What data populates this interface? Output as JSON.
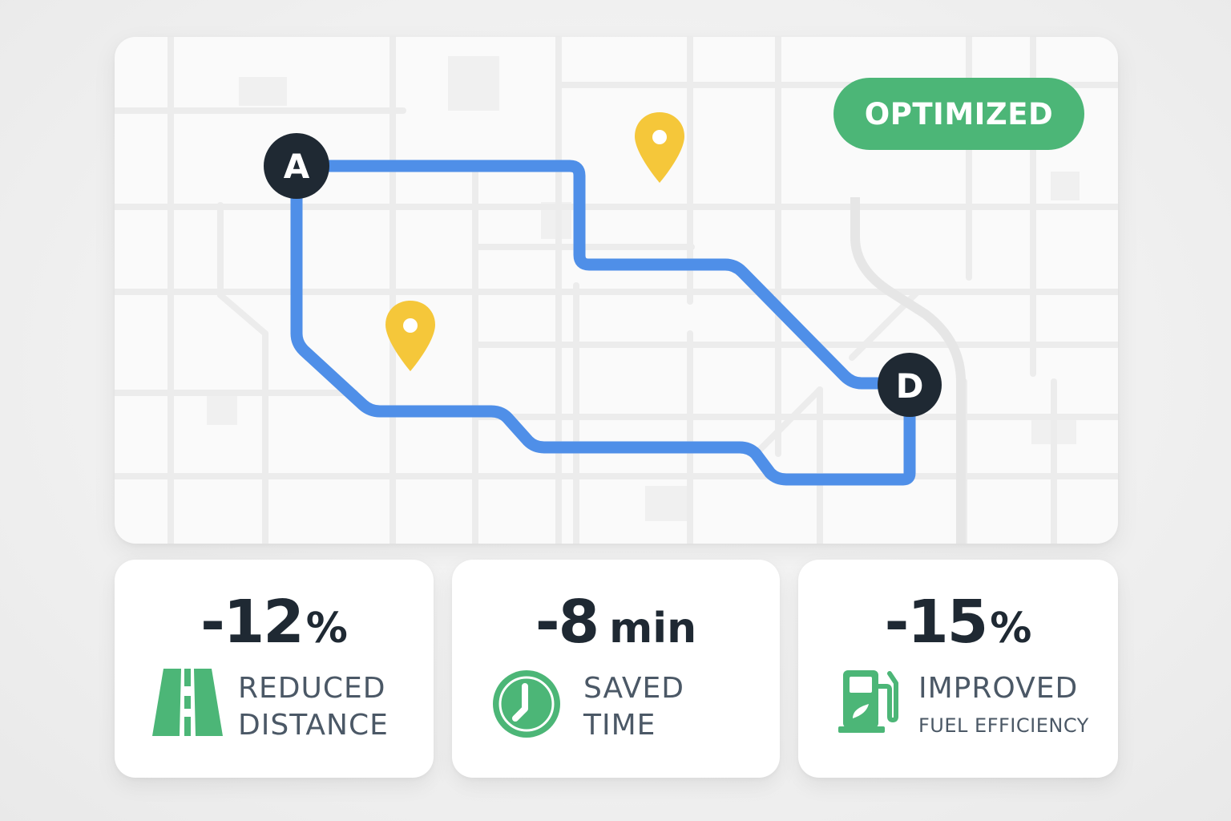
{
  "map": {
    "badge": "OPTIMIZED",
    "start_marker": "A",
    "end_marker": "D",
    "route_color": "#4f8fe8",
    "pin_color": "#f5c73a",
    "marker_color": "#1f2933"
  },
  "stats": [
    {
      "value": "-12",
      "unit": "%",
      "icon": "road-icon",
      "label_line1": "REDUCED",
      "label_line2": "DISTANCE"
    },
    {
      "value": "-8",
      "unit": "min",
      "icon": "clock-icon",
      "label_line1": "SAVED",
      "label_line2": "TIME"
    },
    {
      "value": "-15",
      "unit": "%",
      "icon": "fuel-pump-icon",
      "label_line1": "IMPROVED",
      "label_line2": "FUEL EFFICIENCY"
    }
  ],
  "colors": {
    "accent_green": "#4cb677",
    "text_dark": "#1f2933",
    "text_label": "#4b5866"
  }
}
